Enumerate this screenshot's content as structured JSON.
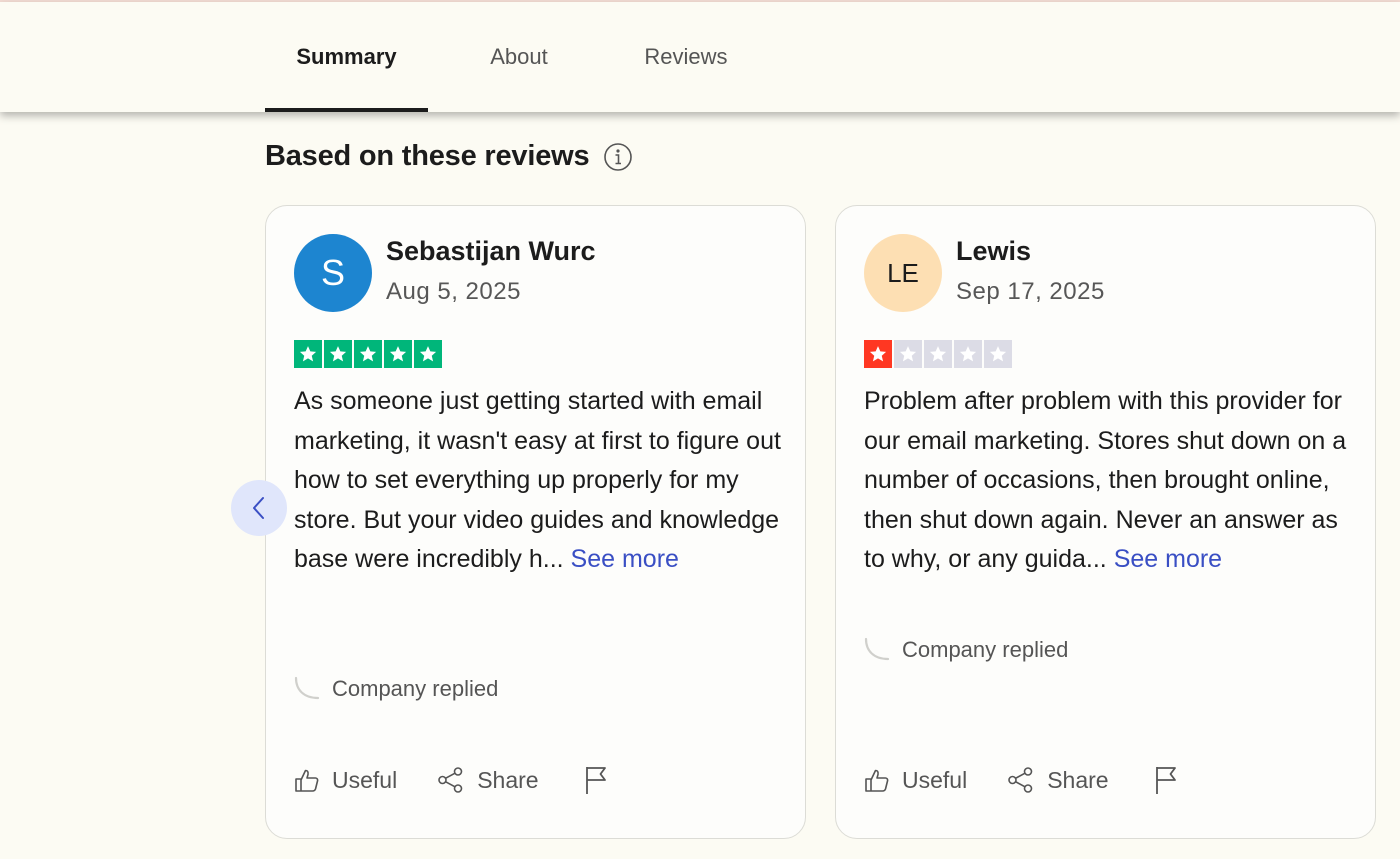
{
  "tabs": [
    {
      "label": "Summary",
      "active": true
    },
    {
      "label": "About",
      "active": false
    },
    {
      "label": "Reviews",
      "active": false
    }
  ],
  "section": {
    "title": "Based on these reviews",
    "info_icon": "info-icon"
  },
  "carousel": {
    "prev_icon": "chevron-left-icon"
  },
  "reviews": [
    {
      "name": "Sebastijan Wurc",
      "initials": "S",
      "avatar_color": "#1d85d0",
      "date": "Aug 5, 2025",
      "rating": 5,
      "text": "As someone just getting started with email marketing, it wasn't easy at first to figure out how to set everything up properly for my store. But your video guides and knowledge base were incredibly h...",
      "see_more": "See more",
      "company_replied": "Company replied",
      "useful_label": "Useful",
      "share_label": "Share"
    },
    {
      "name": "Lewis",
      "initials": "LE",
      "avatar_color": "#fddfb3",
      "date": "Sep 17, 2025",
      "rating": 1,
      "text": "Problem after problem with this provider for our email marketing. Stores shut down on a number of occasions, then brought online, then shut down again. Never an answer as to why, or any guida...",
      "see_more": "See more",
      "company_replied": "Company replied",
      "useful_label": "Useful",
      "share_label": "Share"
    }
  ],
  "colors": {
    "five_star": "#00b67a",
    "one_star": "#ff3722",
    "empty_star": "#dcdce6",
    "link": "#3a4fc4"
  }
}
